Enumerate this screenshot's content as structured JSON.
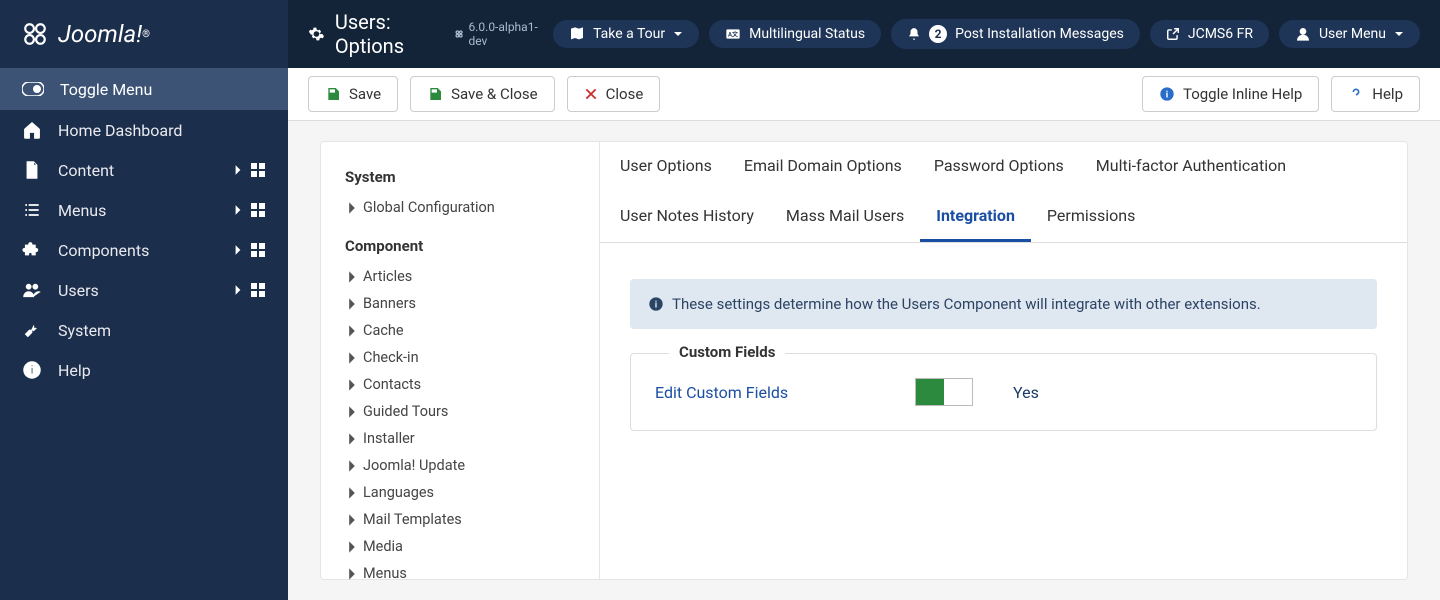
{
  "brand": "Joomla!",
  "sidebar": {
    "toggle": "Toggle Menu",
    "items": [
      {
        "label": "Home Dashboard",
        "icon": "home",
        "expand": false
      },
      {
        "label": "Content",
        "icon": "file",
        "expand": true
      },
      {
        "label": "Menus",
        "icon": "list",
        "expand": true
      },
      {
        "label": "Components",
        "icon": "puzzle",
        "expand": true
      },
      {
        "label": "Users",
        "icon": "users",
        "expand": true
      },
      {
        "label": "System",
        "icon": "wrench",
        "expand": false
      },
      {
        "label": "Help",
        "icon": "info",
        "expand": false
      }
    ]
  },
  "topbar": {
    "title": "Users: Options",
    "version": "6.0.0-alpha1-dev",
    "pills": {
      "tour": "Take a Tour",
      "multilingual": "Multilingual Status",
      "notifications_count": "2",
      "notifications_label": "Post Installation Messages",
      "sitelink": "JCMS6 FR",
      "usermenu": "User Menu"
    }
  },
  "toolbar": {
    "save": "Save",
    "save_close": "Save & Close",
    "close": "Close",
    "toggle_help": "Toggle Inline Help",
    "help": "Help"
  },
  "config_panel": {
    "system_heading": "System",
    "system_items": [
      "Global Configuration"
    ],
    "component_heading": "Component",
    "component_items": [
      "Articles",
      "Banners",
      "Cache",
      "Check-in",
      "Contacts",
      "Guided Tours",
      "Installer",
      "Joomla! Update",
      "Languages",
      "Mail Templates",
      "Media",
      "Menus"
    ]
  },
  "tabs": [
    "User Options",
    "Email Domain Options",
    "Password Options",
    "Multi-factor Authentication",
    "User Notes History",
    "Mass Mail Users",
    "Integration",
    "Permissions"
  ],
  "active_tab": "Integration",
  "banner": "These settings determine how the Users Component will integrate with other extensions.",
  "fieldset": {
    "legend": "Custom Fields",
    "row_label": "Edit Custom Fields",
    "row_value": "Yes"
  }
}
